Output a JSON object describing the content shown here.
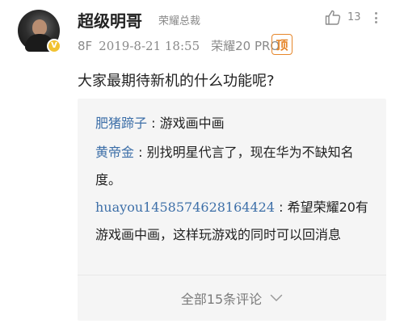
{
  "post": {
    "username": "超级明哥",
    "user_title": "荣耀总裁",
    "like_count": "13",
    "floor": "8F",
    "timestamp": "2019-8-21 18:55",
    "device": "荣耀20 PRO",
    "top_badge": "顶",
    "content": "大家最期待新机的什么功能呢?",
    "verified_badge": "V"
  },
  "replies": [
    {
      "author": "肥猪蹄子",
      "separator": " : ",
      "text": "游戏画中画"
    },
    {
      "author": "黄帝金",
      "separator": " : ",
      "text": "别找明星代言了，现在华为不缺知名度。"
    },
    {
      "author": "huayou1458574628164424",
      "separator": " : ",
      "text": "希望荣耀20有游戏画中画，这样玩游戏的同时可以回消息"
    }
  ],
  "all_comments": {
    "label": "全部15条评论"
  },
  "icons": {
    "like": "thumbs-up-icon",
    "more": "more-vertical-icon",
    "expand": "chevron-down-icon"
  },
  "colors": {
    "link": "#3d6fa8",
    "badge": "#e6862a",
    "verified": "#f1c232",
    "muted": "#8a8a8a"
  }
}
